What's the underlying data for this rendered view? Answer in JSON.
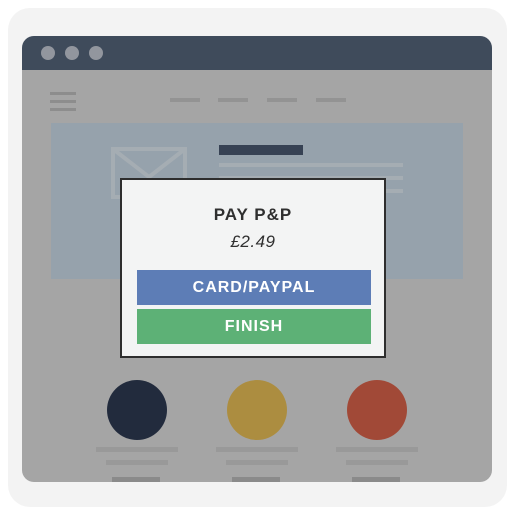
{
  "dialog": {
    "title": "PAY P&P",
    "price": "£2.49",
    "card_button_label": "CARD/PAYPAL",
    "finish_button_label": "FINISH"
  },
  "colors": {
    "titlebar": "#54647a",
    "card_button": "#5d7db6",
    "finish_button": "#5db176",
    "circle_1": "#2e3a52",
    "circle_2": "#e6bd56",
    "circle_3": "#d7624a"
  },
  "icons": [
    "window-dot-icon",
    "hamburger-icon",
    "envelope-icon"
  ]
}
